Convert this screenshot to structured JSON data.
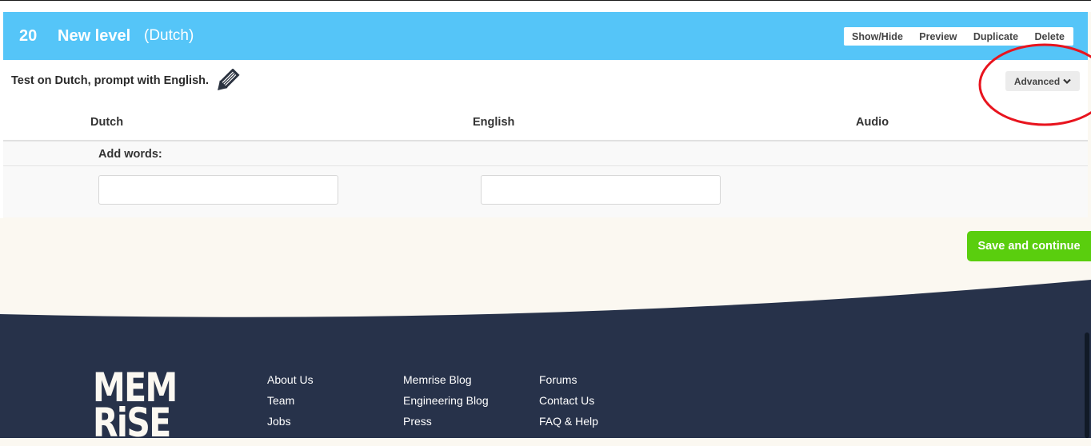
{
  "level": {
    "number": "20",
    "name": "New level",
    "language": "(Dutch)",
    "actions": [
      "Show/Hide",
      "Preview",
      "Duplicate",
      "Delete"
    ]
  },
  "prompt": "Test on Dutch, prompt with English.",
  "advanced_label": "Advanced",
  "columns": [
    "Dutch",
    "English",
    "Audio"
  ],
  "add_words_label": "Add words:",
  "inputs": {
    "dutch_value": "",
    "english_value": ""
  },
  "save_label": "Save and continue",
  "footer": {
    "logo_lines": [
      "MEM",
      "RiSE"
    ],
    "col1": [
      "About Us",
      "Team",
      "Jobs"
    ],
    "col2": [
      "Memrise Blog",
      "Engineering Blog",
      "Press"
    ],
    "col3": [
      "Forums",
      "Contact Us",
      "FAQ & Help"
    ]
  },
  "colors": {
    "header": "#55c5f8",
    "save": "#5ace0e",
    "footer": "#27324a",
    "page": "#fbf8f1",
    "annotation": "#e8141e"
  },
  "icons": [
    "pencil-icon",
    "chevron-down-icon"
  ]
}
